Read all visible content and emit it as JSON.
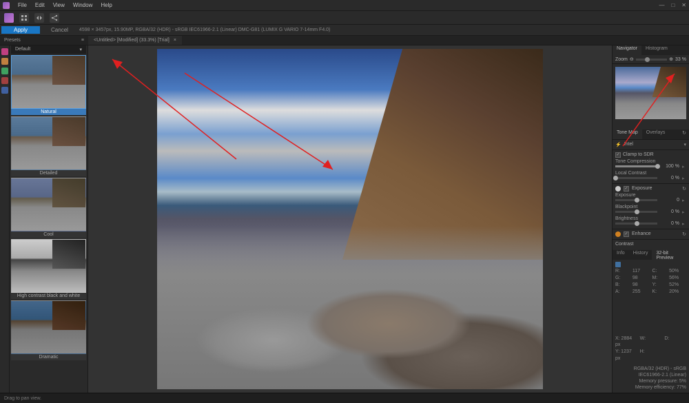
{
  "menu": {
    "file": "File",
    "edit": "Edit",
    "view": "View",
    "window": "Window",
    "help": "Help"
  },
  "action": {
    "apply": "Apply",
    "cancel": "Cancel"
  },
  "file_info": "4598 × 3457px, 15.90MP, RGBA/32 (HDR) - sRGB IEC61966-2.1 (Linear)    DMC-G81  (LUMIX G VARIO 7-14mm F4.0)",
  "doc_tab": "<Untitled> [Modified] (33.3%) [Trial]",
  "presets": {
    "header": "Presets",
    "dropdown": "Default",
    "items": [
      {
        "label": "Natural"
      },
      {
        "label": "Detailed"
      },
      {
        "label": "Cool"
      },
      {
        "label": "High contrast black and white"
      },
      {
        "label": "Dramatic"
      }
    ]
  },
  "right": {
    "tabs": {
      "navigator": "Navigator",
      "histogram": "Histogram"
    },
    "zoom": {
      "label": "Zoom",
      "value": "33 %"
    },
    "tonemap": {
      "tab1": "Tone Map",
      "tab2": "Overlays",
      "preset": "Intel"
    },
    "clamp": "Clamp to SDR",
    "compression": {
      "label": "Tone Compression",
      "value": "100 %"
    },
    "localcontrast": {
      "label": "Local Contrast",
      "value": "0 %"
    },
    "exposure_section": "Exposure",
    "exposure": {
      "label": "Exposure",
      "value": "0"
    },
    "blackpoint": {
      "label": "Blackpoint",
      "value": "0 %"
    },
    "brightness": {
      "label": "Brightness",
      "value": "0 %"
    },
    "enhance": "Enhance",
    "contrast": "Contrast",
    "history_tabs": {
      "info": "Info",
      "history": "History",
      "preview": "32-bit Preview"
    },
    "rgba": {
      "r": "R:",
      "rv": "117",
      "g": "G:",
      "gv": "98",
      "b": "B:",
      "bv": "98",
      "a": "A:",
      "av": "255",
      "c": "C:",
      "cv": "50%",
      "m": "M:",
      "mv": "56%",
      "y": "Y:",
      "yv": "52%",
      "k": "K:",
      "kv": "20%"
    },
    "pos": {
      "x": "X: 2884 px",
      "y": "Y: 1237 px",
      "w": "W:",
      "h": "H:",
      "d": "D:"
    },
    "format": "RGBA/32 (HDR) - sRGB IEC61966-2.1 (Linear)",
    "mem1": "Memory pressure: 5%",
    "mem2": "Memory efficiency: 77%"
  },
  "status": "Drag to pan view."
}
